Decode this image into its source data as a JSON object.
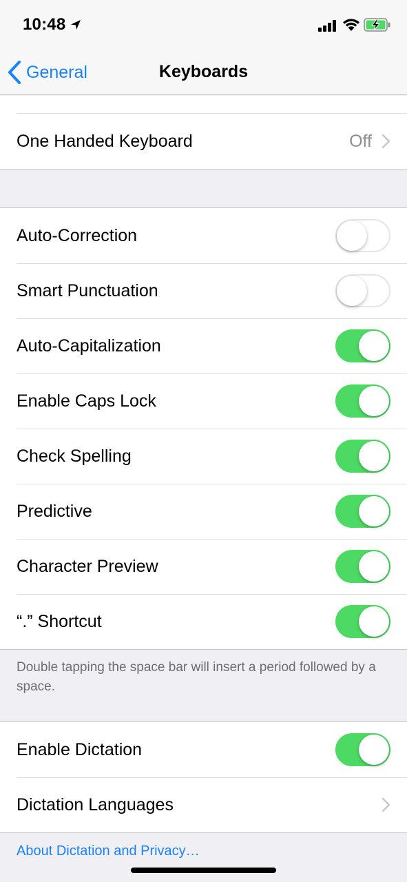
{
  "status_bar": {
    "time": "10:48",
    "icons": [
      "location-arrow-icon",
      "cellular-signal-icon",
      "wifi-icon",
      "battery-charging-icon"
    ]
  },
  "nav": {
    "back_label": "General",
    "title": "Keyboards"
  },
  "one_handed": {
    "label": "One Handed Keyboard",
    "value": "Off"
  },
  "toggles": [
    {
      "label": "Auto-Correction",
      "on": false
    },
    {
      "label": "Smart Punctuation",
      "on": false
    },
    {
      "label": "Auto-Capitalization",
      "on": true
    },
    {
      "label": "Enable Caps Lock",
      "on": true
    },
    {
      "label": "Check Spelling",
      "on": true
    },
    {
      "label": "Predictive",
      "on": true
    },
    {
      "label": "Character Preview",
      "on": true
    },
    {
      "label": "“.” Shortcut",
      "on": true
    }
  ],
  "shortcut_footer": "Double tapping the space bar will insert a period followed by a space.",
  "dictation": {
    "enable_label": "Enable Dictation",
    "enable_on": true,
    "languages_label": "Dictation Languages",
    "privacy_link": "About Dictation and Privacy…"
  },
  "colors": {
    "accent": "#1a82fb",
    "toggle_on": "#4cd964",
    "background": "#efeff4",
    "secondary_text": "#8e8e93"
  }
}
